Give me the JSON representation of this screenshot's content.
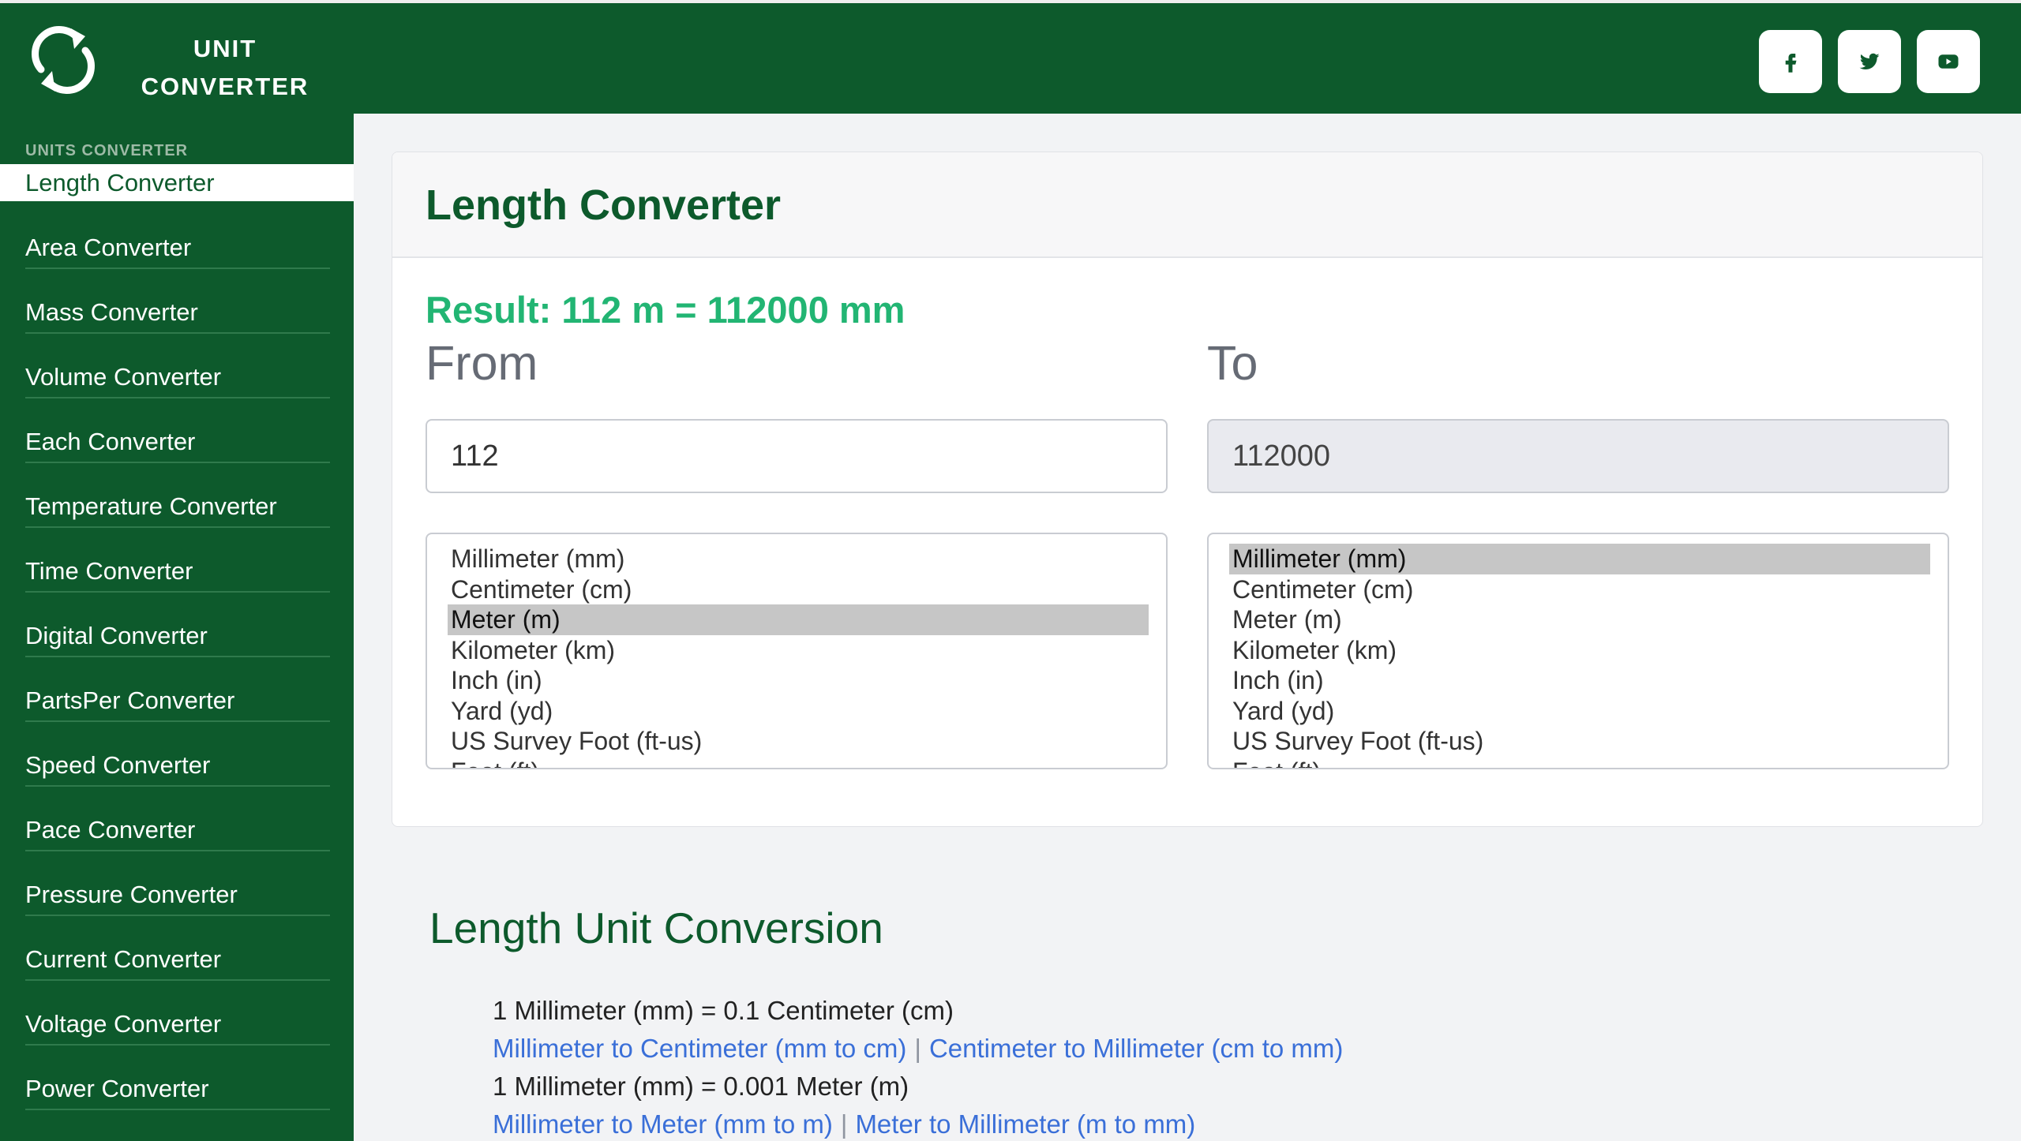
{
  "brand": {
    "line1": "UNIT",
    "line2": "CONVERTER"
  },
  "social": [
    {
      "icon": "facebook-icon"
    },
    {
      "icon": "twitter-icon"
    },
    {
      "icon": "youtube-icon"
    }
  ],
  "sidebar": {
    "section": "UNITS CONVERTER",
    "items": [
      "Length Converter",
      "Area Converter",
      "Mass Converter",
      "Volume Converter",
      "Each Converter",
      "Temperature Converter",
      "Time Converter",
      "Digital Converter",
      "PartsPer Converter",
      "Speed Converter",
      "Pace Converter",
      "Pressure Converter",
      "Current Converter",
      "Voltage Converter",
      "Power Converter"
    ],
    "active_index": 0
  },
  "card": {
    "title": "Length Converter",
    "result": "Result: 112 m = 112000 mm",
    "from_label": "From",
    "to_label": "To",
    "from_value": "112",
    "to_value": "112000",
    "units": [
      "Millimeter (mm)",
      "Centimeter (cm)",
      "Meter (m)",
      "Kilometer (km)",
      "Inch (in)",
      "Yard (yd)",
      "US Survey Foot (ft-us)",
      "Foot (ft)"
    ],
    "from_selected": 2,
    "to_selected": 0
  },
  "conversion": {
    "title": "Length Unit Conversion",
    "rows": [
      {
        "equation": "1 Millimeter (mm) = 0.1 Centimeter (cm)",
        "link_a": "Millimeter to Centimeter (mm to cm)",
        "sep": "|",
        "link_b": "Centimeter to Millimeter (cm to mm)"
      },
      {
        "equation": "1 Millimeter (mm) = 0.001 Meter (m)",
        "link_a": "Millimeter to Meter (mm to m)",
        "sep": "|",
        "link_b": "Meter to Millimeter (m to mm)"
      }
    ]
  },
  "colors": {
    "brand_green": "#0d5a2c",
    "result_green": "#22b573",
    "link_blue": "#3a6fd8"
  }
}
